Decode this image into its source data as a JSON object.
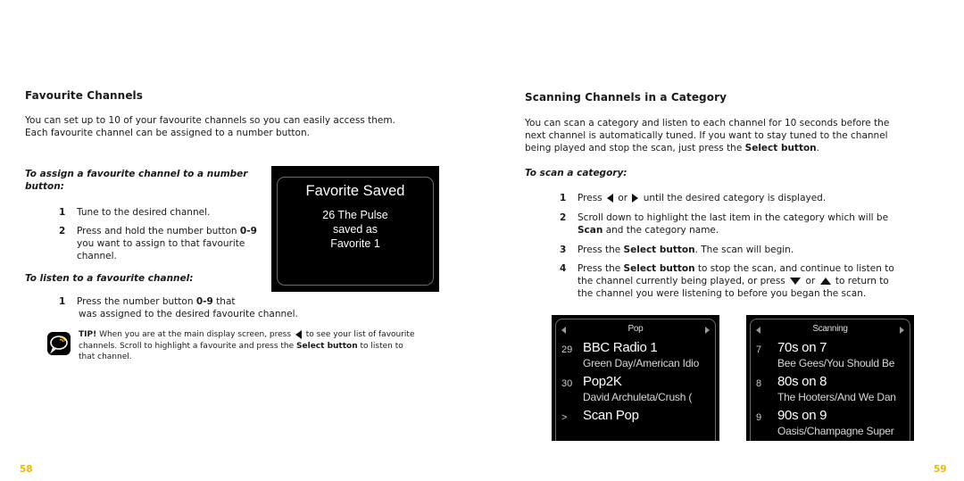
{
  "left_page": {
    "heading": "Favourite Channels",
    "intro_line1": "You can set up to 10 of your favourite channels so you can easily access them.",
    "intro_line2": "Each favourite channel can be assigned to a number button.",
    "assign_heading_line1": "To assign a favourite channel to a number",
    "assign_heading_line2": "button:",
    "assign_steps": [
      {
        "num": "1",
        "text": "Tune to the desired channel."
      },
      {
        "num": "2",
        "text_a": "Press and hold the number button ",
        "text_bold": "0-9",
        "text_b": "you want to assign to that favourite",
        "text_c": "channel."
      }
    ],
    "listen_heading": "To listen to a favourite channel:",
    "listen_steps": [
      {
        "num": "1",
        "text_a": "Press the number button ",
        "text_bold": "0-9",
        "text_b": " that",
        "text_c": "was assigned to the desired favourite channel."
      }
    ],
    "tip": {
      "label": "TIP!",
      "text_a": " When you are at the main display screen, press ",
      "text_b": " to see your list of favourite",
      "line2_a": "channels. Scroll to highlight a favourite and press the ",
      "line2_bold": "Select button",
      "line2_b": " to listen to",
      "line3": "that channel."
    },
    "favorite_screen": {
      "title": "Favorite Saved",
      "line1": "26 The Pulse",
      "line2": "saved as",
      "line3": "Favorite 1"
    },
    "page_number": "58"
  },
  "right_page": {
    "heading": "Scanning Channels in a Category",
    "intro_line1": "You can scan a category and listen to each channel for 10 seconds before the",
    "intro_line2": "next channel is automatically tuned. If you want to stay tuned to the channel",
    "intro_line3_a": "being played and stop the scan, just press the ",
    "intro_line3_bold": "Select button",
    "intro_line3_b": ".",
    "scan_heading": "To scan a category:",
    "steps": {
      "s1": {
        "num": "1",
        "a": "Press ",
        "b": " or ",
        "c": " until the desired category is displayed."
      },
      "s2": {
        "num": "2",
        "a": "Scroll down to highlight the last item in the category which will be",
        "bold": "Scan",
        "b": " and the category name."
      },
      "s3": {
        "num": "3",
        "a": "Press the ",
        "bold": "Select button",
        "b": ". The scan will begin."
      },
      "s4": {
        "num": "4",
        "a": "Press the ",
        "bold": "Select button",
        "b": " to stop the scan, and continue to listen to",
        "c": "the channel currently being played, or press ",
        "d": " or ",
        "e": " to return to",
        "f": "the channel you were listening to before you began the scan."
      }
    },
    "pop_screen": {
      "header": "Pop",
      "rows": [
        {
          "num": "29",
          "name": "BBC Radio 1",
          "song": "Green Day/American Idio"
        },
        {
          "num": "30",
          "name": "Pop2K",
          "song": "David Archuleta/Crush ("
        },
        {
          "num": ">",
          "name": "Scan Pop",
          "song": ""
        }
      ]
    },
    "scanning_screen": {
      "header": "Scanning",
      "rows": [
        {
          "num": "7",
          "name": "70s on 7",
          "song": "Bee Gees/You Should Be"
        },
        {
          "num": "8",
          "name": "80s on 8",
          "song": "The Hooters/And We Dan"
        },
        {
          "num": "9",
          "name": "90s on 9",
          "song": "Oasis/Champagne Super"
        }
      ]
    },
    "page_number": "59"
  },
  "colors": {
    "page_number": "#f2b800",
    "screen_bg": "#000000",
    "tip_icon_accent": "#f2b800"
  }
}
